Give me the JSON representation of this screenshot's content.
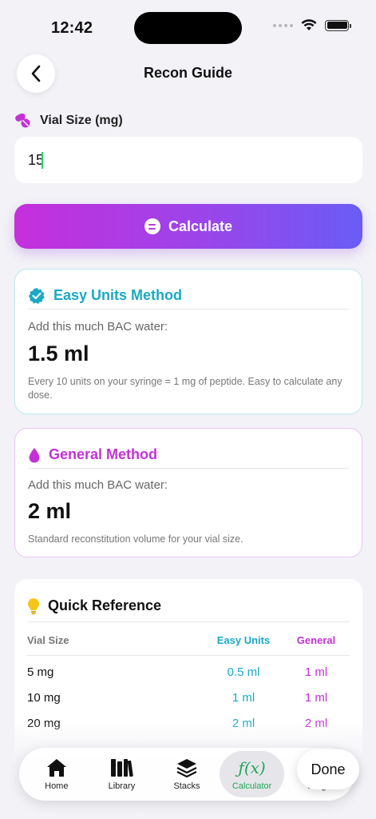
{
  "status": {
    "time": "12:42"
  },
  "header": {
    "title": "Recon Guide"
  },
  "vial": {
    "label": "Vial Size (mg)",
    "value": "15"
  },
  "calculate": {
    "label": "Calculate"
  },
  "easy": {
    "title": "Easy Units Method",
    "sub": "Add this much BAC water:",
    "value": "1.5 ml",
    "note": "Every 10 units on your syringe = 1 mg of peptide. Easy to calculate any dose."
  },
  "general": {
    "title": "General Method",
    "sub": "Add this much BAC water:",
    "value": "2 ml",
    "note": "Standard reconstitution volume for your vial size."
  },
  "reference": {
    "title": "Quick Reference",
    "headers": [
      "Vial Size",
      "Easy Units",
      "General"
    ],
    "rows": [
      [
        "5 mg",
        "0.5 ml",
        "1 ml"
      ],
      [
        "10 mg",
        "1 ml",
        "1 ml"
      ],
      [
        "20 mg",
        "2 ml",
        "2 ml"
      ]
    ]
  },
  "tabs": [
    {
      "label": "Home",
      "icon": "home-icon"
    },
    {
      "label": "Library",
      "icon": "library-icon"
    },
    {
      "label": "Stacks",
      "icon": "stacks-icon"
    },
    {
      "label": "Calculator",
      "icon": "function-icon",
      "glyph": "ƒ(x)"
    },
    {
      "label": "Prog",
      "icon": "progress-icon"
    }
  ],
  "done": {
    "label": "Done"
  },
  "colors": {
    "accent_teal": "#1aa9c4",
    "accent_magenta": "#c331d6",
    "active_green": "#1fa85a",
    "gradient_start": "#c62fdc",
    "gradient_end": "#6a5cf5"
  }
}
